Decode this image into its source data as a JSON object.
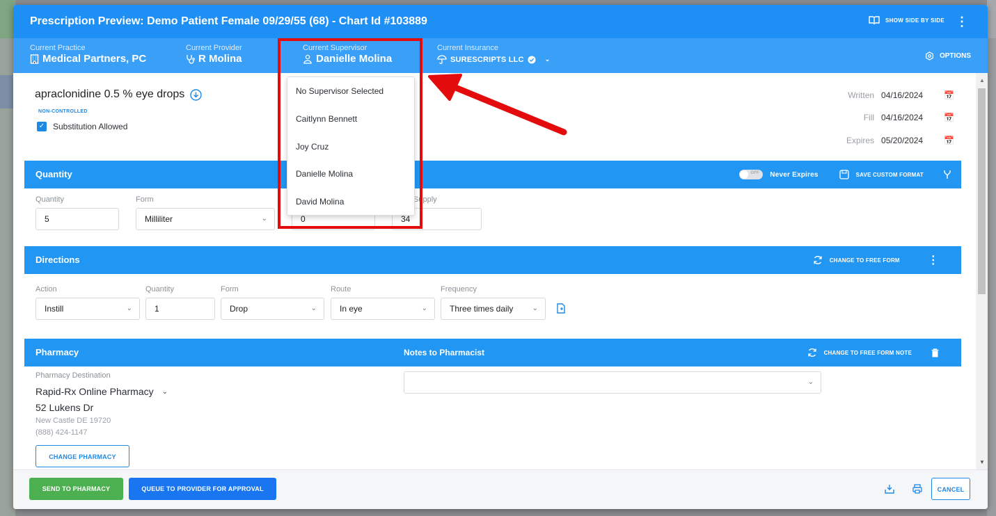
{
  "modal": {
    "title": "Prescription Preview: Demo Patient Female 09/29/55 (68) - Chart Id #103889",
    "show_side_by_side": "SHOW SIDE BY SIDE",
    "kebab": "⋮"
  },
  "context": {
    "practice_label": "Current Practice",
    "practice_value": "Medical Partners, PC",
    "provider_label": "Current Provider",
    "provider_value": "R Molina",
    "supervisor_label": "Current Supervisor",
    "supervisor_value": "Danielle Molina",
    "insurance_label": "Current Insurance",
    "insurance_value": "SURESCRIPTS LLC",
    "options_label": "OPTIONS"
  },
  "drug": {
    "name": "apraclonidine 0.5 % eye drops",
    "badge": "NON-CONTROLLED",
    "substitution_label": "Substitution Allowed",
    "substitution_checked": true
  },
  "dates": [
    {
      "label": "Written",
      "value": "04/16/2024"
    },
    {
      "label": "Fill",
      "value": "04/16/2024"
    },
    {
      "label": "Expires",
      "value": "05/20/2024"
    }
  ],
  "quantity_section": {
    "title": "Quantity",
    "toggle_state": "OFF",
    "never_expires": "Never Expires",
    "save_custom_format": "SAVE CUSTOM FORMAT",
    "quantity_label": "Quantity",
    "quantity_value": "5",
    "form_label": "Form",
    "form_value": "Milliliter",
    "supply_label": "Supply",
    "refills_value": "0",
    "supply_value": "34"
  },
  "directions_section": {
    "title": "Directions",
    "change_free_form": "CHANGE TO FREE FORM",
    "action_label": "Action",
    "action_value": "Instill",
    "quantity_label": "Quantity",
    "quantity_value": "1",
    "form_label": "Form",
    "form_value": "Drop",
    "route_label": "Route",
    "route_value": "In eye",
    "frequency_label": "Frequency",
    "frequency_value": "Three times daily"
  },
  "pharmacy_section": {
    "title": "Pharmacy",
    "notes_title": "Notes to Pharmacist",
    "change_free_form_note": "CHANGE TO FREE FORM NOTE",
    "destination_label": "Pharmacy Destination",
    "name": "Rapid-Rx Online Pharmacy",
    "address": "52 Lukens Dr",
    "city": "New Castle DE 19720",
    "phone": "(888) 424-1147",
    "change_pharmacy": "CHANGE PHARMACY",
    "notes_value": ""
  },
  "footer": {
    "send": "SEND TO PHARMACY",
    "queue": "QUEUE TO PROVIDER FOR APPROVAL",
    "cancel": "CANCEL"
  },
  "supervisor_dropdown": {
    "items": [
      "No Supervisor Selected",
      "Caitlynn Bennett",
      "Joy Cruz",
      "Danielle Molina",
      "David Molina"
    ]
  },
  "colors": {
    "primary": "#1e90f5",
    "section": "#2196f3",
    "send": "#4caf50",
    "queue": "#1976f0",
    "annotation": "#e30b0b"
  }
}
